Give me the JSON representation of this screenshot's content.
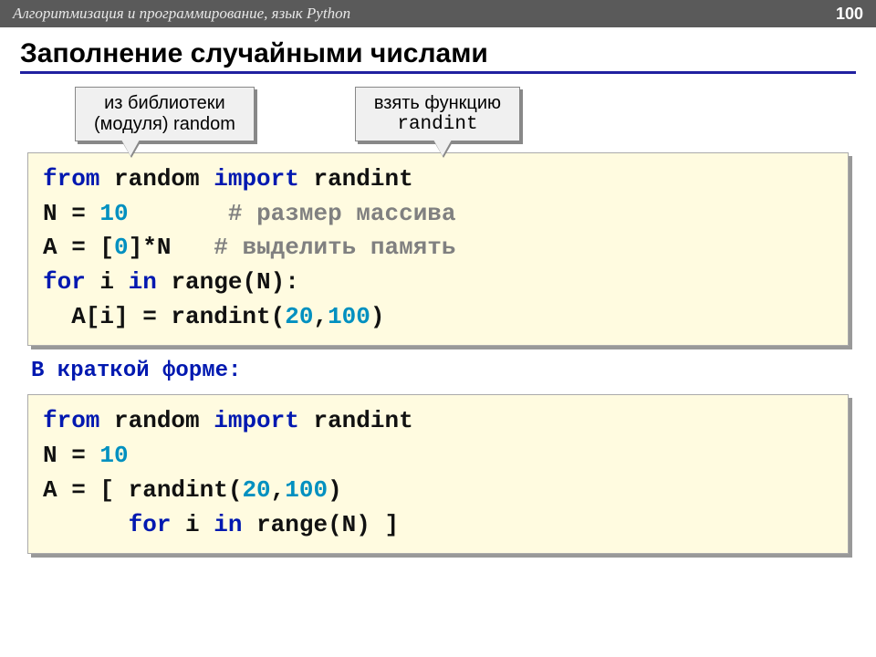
{
  "header": {
    "title": "Алгоритмизация и программирование, язык Python",
    "page": "100"
  },
  "title": "Заполнение случайными числами",
  "callouts": {
    "c1_line1": "из библиотеки",
    "c1_line2": "(модуля) random",
    "c2_line1": "взять функцию",
    "c2_line2": "randint"
  },
  "code1": {
    "l1a": "from",
    "l1b": " random ",
    "l1c": "import",
    "l1d": " randint",
    "l2a": "N = ",
    "l2b": "10",
    "l2c": "       ",
    "l2d": "# размер массива",
    "l3a": "A = [",
    "l3b": "0",
    "l3c": "]*N   ",
    "l3d": "# выделить память",
    "l4a": "for",
    "l4b": " i ",
    "l4c": "in",
    "l4d": " range(N):",
    "l5a": "  A[i] = randint(",
    "l5b": "20",
    "l5c": ",",
    "l5d": "100",
    "l5e": ")"
  },
  "subtitle": "В краткой форме:",
  "code2": {
    "l1a": "from",
    "l1b": " random ",
    "l1c": "import",
    "l1d": " randint",
    "l2a": "N = ",
    "l2b": "10",
    "l3a": "A = [ randint(",
    "l3b": "20",
    "l3c": ",",
    "l3d": "100",
    "l3e": ") ",
    "l4a": "      ",
    "l4b": "for",
    "l4c": " i ",
    "l4d": "in",
    "l4e": " range(N) ]"
  }
}
